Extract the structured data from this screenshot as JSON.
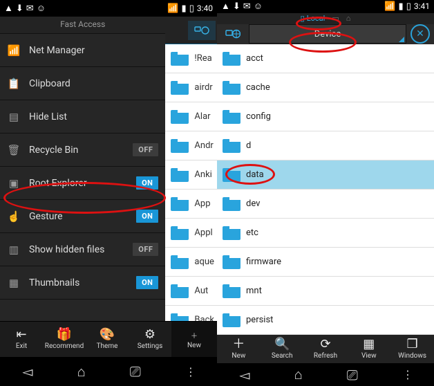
{
  "status": {
    "left_icons": [
      "warning",
      "download",
      "mail",
      "whatsapp"
    ],
    "right_icons": [
      "wifi",
      "signal",
      "signal",
      "battery"
    ],
    "time_left": "3:40",
    "time_right": "3:41"
  },
  "fast_access": {
    "title": "Fast Access",
    "items": [
      {
        "icon": "wifi",
        "label": "Net Manager"
      },
      {
        "icon": "clipboard",
        "label": "Clipboard"
      },
      {
        "icon": "hide",
        "label": "Hide List"
      },
      {
        "icon": "trash",
        "label": "Recycle Bin",
        "toggle": "OFF"
      },
      {
        "icon": "root",
        "label": "Root Explorer",
        "toggle": "ON"
      },
      {
        "icon": "gesture",
        "label": "Gesture",
        "toggle": "ON"
      },
      {
        "icon": "hidden",
        "label": "Show hidden files",
        "toggle": "OFF"
      },
      {
        "icon": "thumbs",
        "label": "Thumbnails",
        "toggle": "ON"
      }
    ]
  },
  "left_strip_folders": [
    "!Rea",
    "airdr",
    "Alar",
    "Andr",
    "Anki",
    "App",
    "Appl",
    "aque",
    "Aut",
    "Back"
  ],
  "left_bottom": {
    "items": [
      "Exit",
      "Recommend",
      "Theme",
      "Settings"
    ],
    "new_label": "New"
  },
  "right": {
    "top_tabs": {
      "active": "Local",
      "others": [
        "sd",
        "home"
      ]
    },
    "path": "Device",
    "folders": [
      "acct",
      "cache",
      "config",
      "d",
      "data",
      "dev",
      "etc",
      "firmware",
      "mnt",
      "persist"
    ],
    "selected_index": 4,
    "toolbar": [
      "New",
      "Search",
      "Refresh",
      "View",
      "Windows"
    ]
  }
}
